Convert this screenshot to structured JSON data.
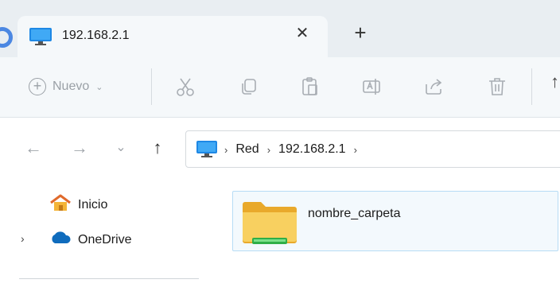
{
  "tab": {
    "title": "192.168.2.1",
    "close_glyph": "✕",
    "new_tab_glyph": "+"
  },
  "toolbar": {
    "new_label": "Nuevo",
    "new_caret": "⌄",
    "extra_glyph": "↑"
  },
  "nav": {
    "back_glyph": "←",
    "forward_glyph": "→",
    "recent_glyph": "⌄",
    "up_glyph": "↑"
  },
  "address": {
    "separator": "›",
    "crumbs": [
      "Red",
      "192.168.2.1"
    ]
  },
  "sidebar": {
    "items": [
      {
        "label": "Inicio",
        "icon": "home-icon"
      },
      {
        "label": "OneDrive",
        "icon": "cloud-icon"
      }
    ],
    "expander_glyph": "›"
  },
  "content": {
    "items": [
      {
        "name": "nombre_carpeta",
        "icon": "folder-icon"
      }
    ]
  },
  "colors": {
    "tabstrip": "#e9eef2",
    "toolbar": "#f5f8fa",
    "selection_border": "#b7dcf5",
    "folder": "#f7c64a",
    "accent": "#2b8fe0"
  }
}
